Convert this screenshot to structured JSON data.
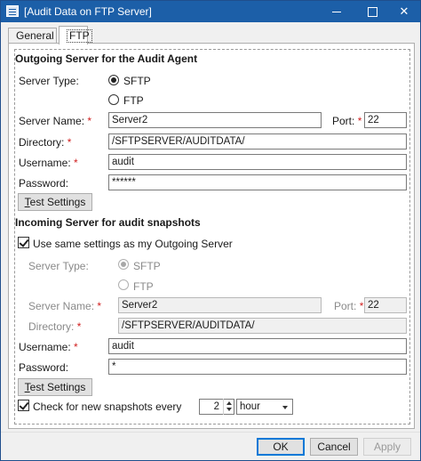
{
  "window": {
    "title": "[Audit Data on FTP Server]"
  },
  "tabs": [
    {
      "label": "General"
    },
    {
      "label": "FTP"
    }
  ],
  "outgoing": {
    "section_title": "Outgoing Server for the Audit Agent",
    "server_type_label": "Server Type:",
    "sftp_label": "SFTP",
    "ftp_label": "FTP",
    "selected_type": "SFTP",
    "server_name_label": "Server Name:",
    "server_name_value": "Server2",
    "port_label": "Port:",
    "port_value": "22",
    "directory_label": "Directory:",
    "directory_value": "/SFTPSERVER/AUDITDATA/",
    "username_label": "Username:",
    "username_value": "audit",
    "password_label": "Password:",
    "password_value": "******",
    "test_button": "Test Settings",
    "required_mark": "*"
  },
  "incoming": {
    "section_title": "Incoming Server for audit snapshots",
    "same_settings_label": "Use same settings as my Outgoing Server",
    "same_settings_checked": true,
    "server_type_label": "Server Type:",
    "sftp_label": "SFTP",
    "ftp_label": "FTP",
    "selected_type": "SFTP",
    "server_name_label": "Server Name:",
    "server_name_value": "Server2",
    "port_label": "Port:",
    "port_value": "22",
    "directory_label": "Directory:",
    "directory_value": "/SFTPSERVER/AUDITDATA/",
    "username_label": "Username:",
    "username_value": "audit",
    "password_label": "Password:",
    "password_value": "*",
    "test_button": "Test Settings",
    "required_mark": "*"
  },
  "snapshots": {
    "check_label": "Check for new snapshots every",
    "checked": true,
    "interval_value": "2",
    "unit_value": "hour"
  },
  "footer": {
    "ok": "OK",
    "cancel": "Cancel",
    "apply": "Apply"
  },
  "colors": {
    "titlebar": "#1c5fa8",
    "required": "#d02020",
    "accent": "#0078d7"
  }
}
